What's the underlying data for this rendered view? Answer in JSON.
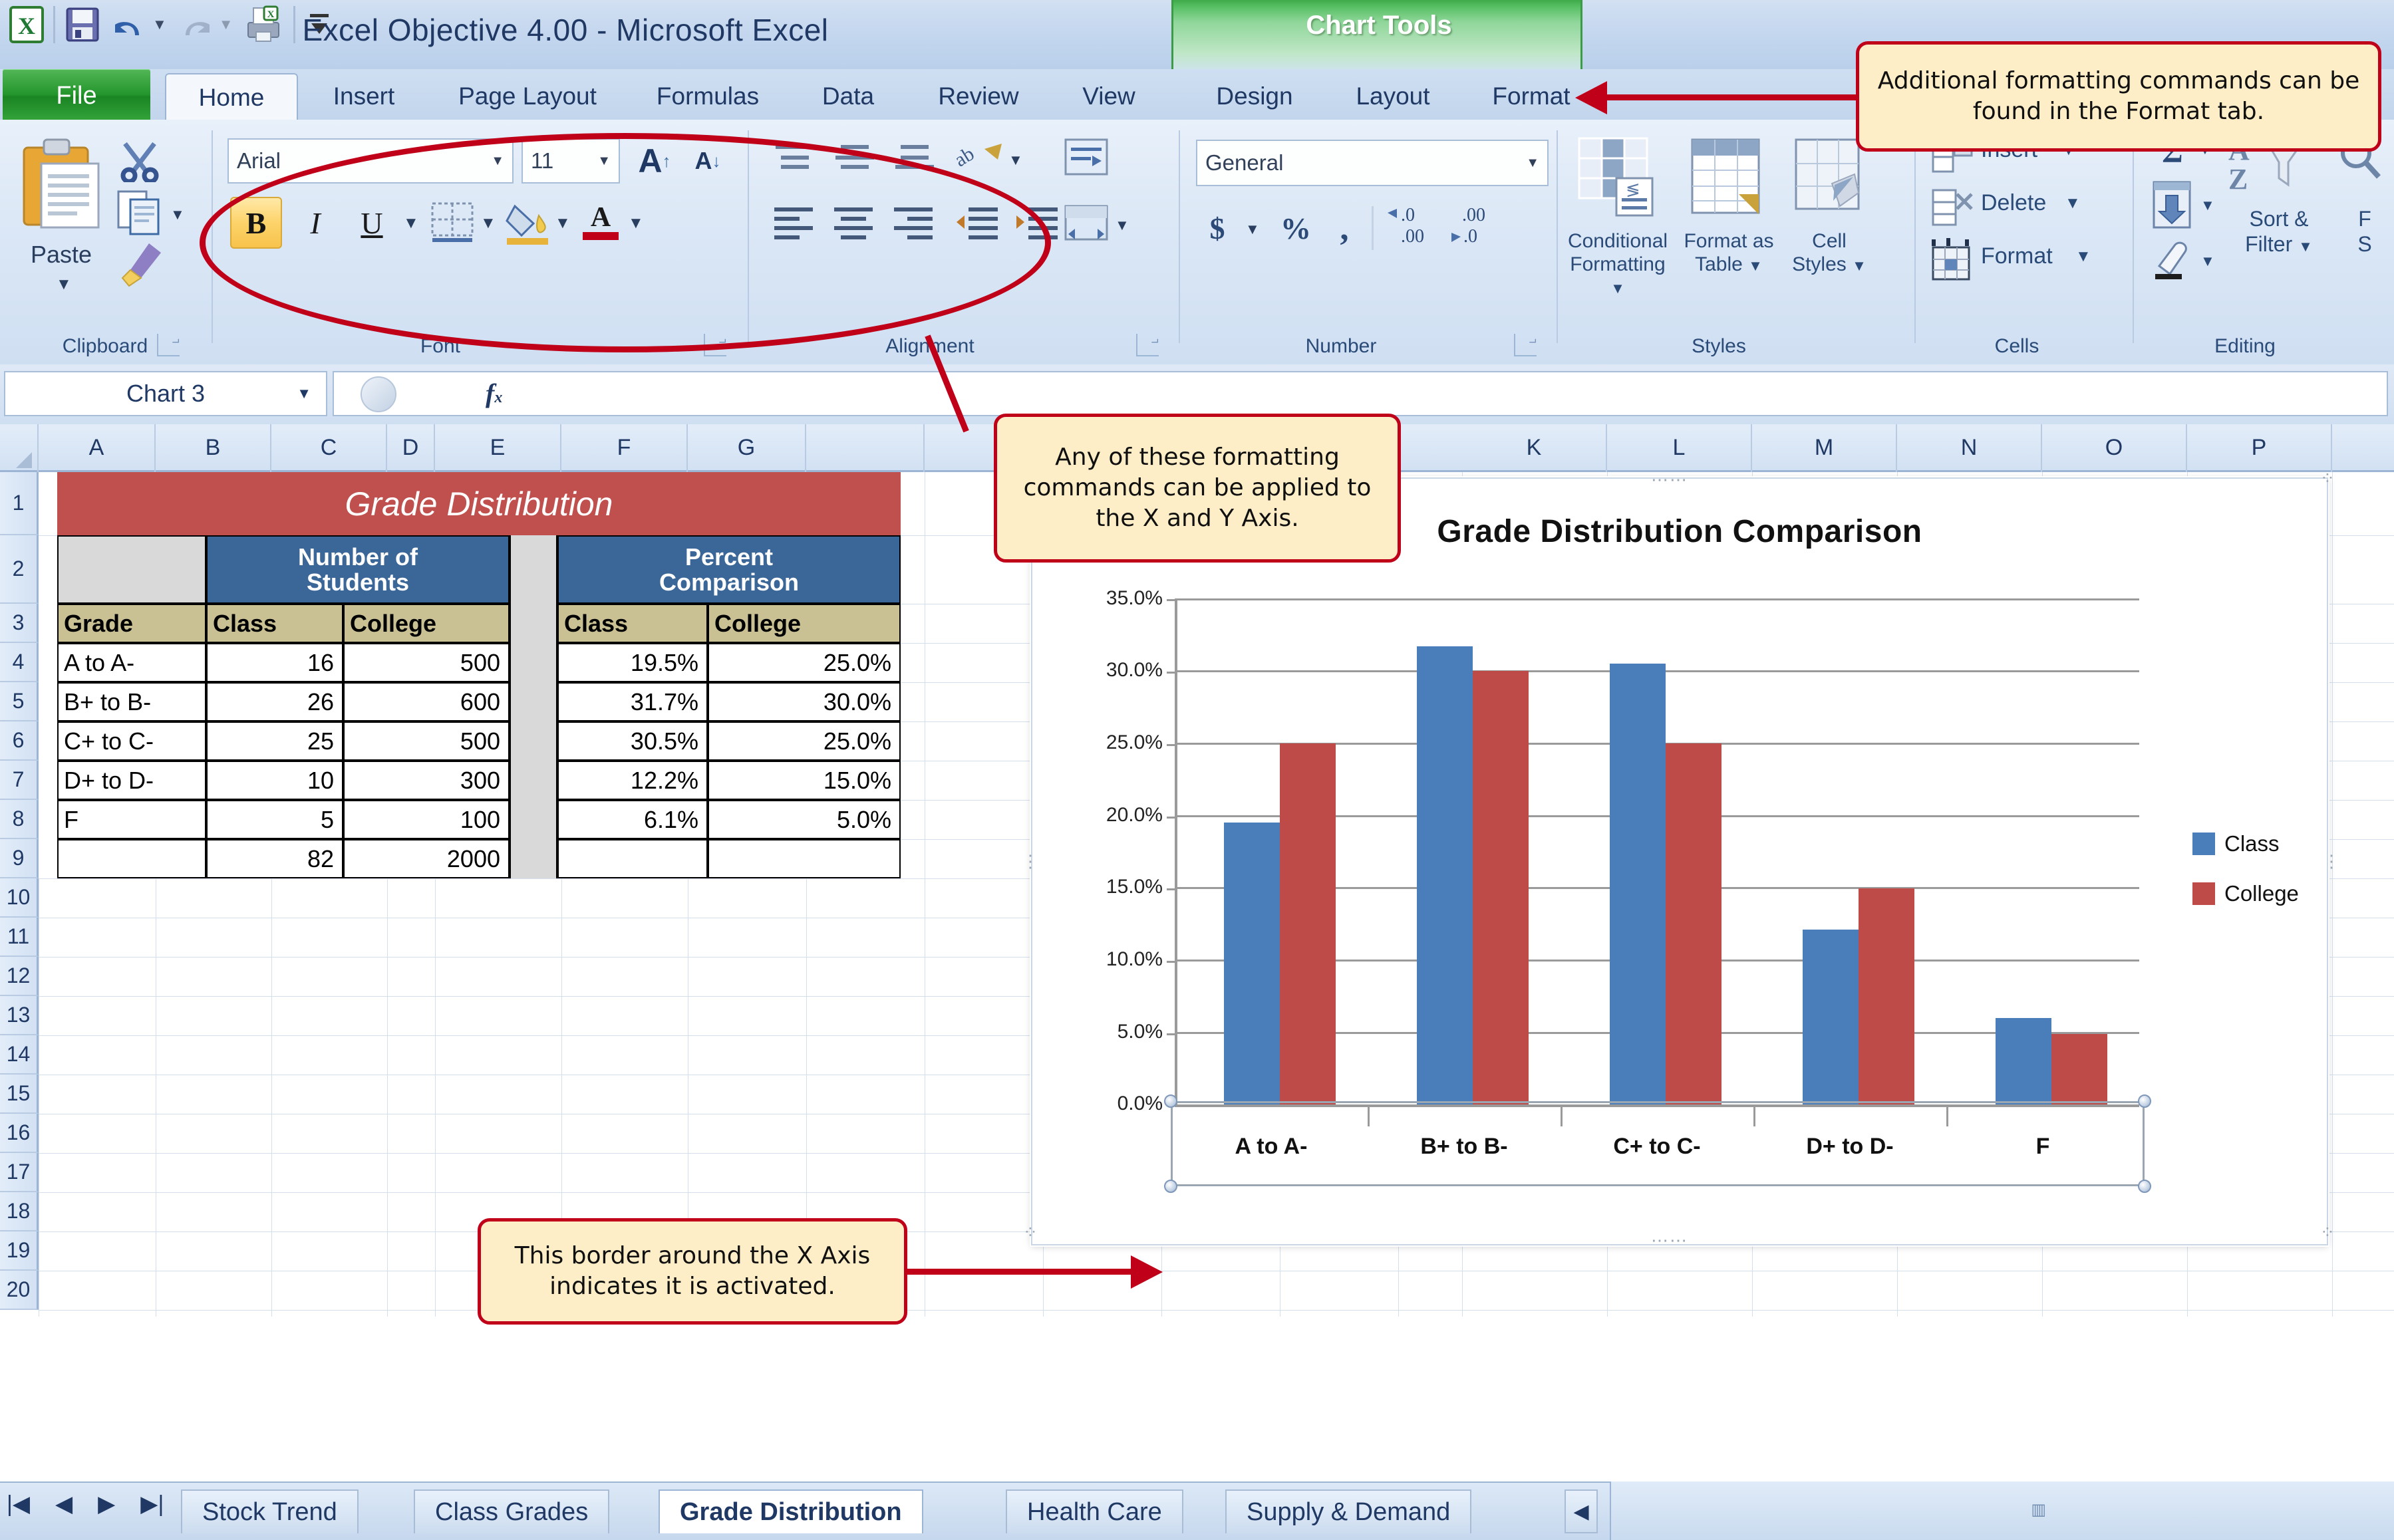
{
  "window": {
    "app_title": "Excel Objective 4.00  -  Microsoft Excel",
    "contextual_tools_label": "Chart Tools"
  },
  "quick_access": {
    "icons": [
      "excel-logo-icon",
      "save-icon",
      "undo-icon",
      "redo-icon",
      "print-preview-icon",
      "customize-qat-icon"
    ]
  },
  "ribbon": {
    "tabs": [
      {
        "label": "File",
        "active": false,
        "style": "file"
      },
      {
        "label": "Home",
        "active": true
      },
      {
        "label": "Insert",
        "active": false
      },
      {
        "label": "Page Layout",
        "active": false
      },
      {
        "label": "Formulas",
        "active": false
      },
      {
        "label": "Data",
        "active": false
      },
      {
        "label": "Review",
        "active": false
      },
      {
        "label": "View",
        "active": false
      }
    ],
    "contextual_tabs": [
      {
        "label": "Design",
        "active": false
      },
      {
        "label": "Layout",
        "active": false
      },
      {
        "label": "Format",
        "active": false
      }
    ],
    "groups": [
      {
        "label": "Clipboard"
      },
      {
        "label": "Font"
      },
      {
        "label": "Alignment"
      },
      {
        "label": "Number"
      },
      {
        "label": "Styles"
      },
      {
        "label": "Cells"
      },
      {
        "label": "Editing"
      }
    ],
    "clipboard": {
      "paste_label": "Paste",
      "cut_icon": "scissors-icon",
      "copy_icon": "copy-icon",
      "format_painter_icon": "format-painter-icon"
    },
    "font": {
      "font_name": "Arial",
      "font_size": "11",
      "grow_font_label": "A",
      "shrink_font_label": "A",
      "bold_label": "B",
      "italic_label": "I",
      "underline_label": "U",
      "borders_icon": "borders-icon",
      "fill_color_icon": "fill-color-icon",
      "font_color_icon": "font-color-icon"
    },
    "alignment": {
      "top_align_icon": "align-top-icon",
      "middle_align_icon": "align-middle-icon",
      "bottom_align_icon": "align-bottom-icon",
      "orientation_icon": "text-orientation-icon",
      "wrap_text_icon": "wrap-text-icon",
      "align_left_icon": "align-left-icon",
      "align_center_icon": "align-center-icon",
      "align_right_icon": "align-right-icon",
      "decrease_indent_icon": "decrease-indent-icon",
      "increase_indent_icon": "increase-indent-icon",
      "merge_center_icon": "merge-and-center-icon"
    },
    "number": {
      "format_value": "General",
      "accounting_icon": "currency-icon",
      "percent_icon": "percent-style-icon",
      "comma_icon": "comma-style-icon",
      "increase_decimal_icon": "increase-decimal-icon",
      "decrease_decimal_icon": "decrease-decimal-icon"
    },
    "styles": {
      "conditional_formatting_label": "Conditional\nFormatting",
      "conditional_line1": "Conditional",
      "conditional_line2": "Formatting",
      "format_as_table_line1": "Format as",
      "format_as_table_line2": "Table",
      "cell_styles_line1": "Cell",
      "cell_styles_line2": "Styles"
    },
    "cells": {
      "insert_label": "Insert",
      "delete_label": "Delete",
      "format_label": "Format"
    },
    "editing": {
      "autosum_icon": "autosum-icon",
      "fill_icon": "fill-down-icon",
      "clear_icon": "clear-eraser-icon",
      "sort_filter_line1": "Sort &",
      "sort_filter_line2": "Filter",
      "find_select_line1": "F",
      "find_select_line2": "S"
    }
  },
  "formula_bar": {
    "name_box_value": "Chart 3",
    "fx_label": "fx",
    "formula_value": ""
  },
  "grid": {
    "columns": [
      "A",
      "B",
      "C",
      "D",
      "E",
      "F",
      "G",
      "K",
      "L",
      "M",
      "N",
      "O",
      "P"
    ],
    "rows": [
      "1",
      "2",
      "3",
      "4",
      "5",
      "6",
      "7",
      "8",
      "9",
      "10",
      "11",
      "12",
      "13",
      "14",
      "15",
      "16",
      "17",
      "18",
      "19",
      "20"
    ]
  },
  "worksheet": {
    "title": "Grade Distribution",
    "group_headers": [
      {
        "label": "Number of Students",
        "line1": "Number of",
        "line2": "Students"
      },
      {
        "label": "Percent Comparison",
        "line1": "Percent",
        "line2": "Comparison"
      }
    ],
    "column_headers": [
      "Grade",
      "Class",
      "College",
      "Class",
      "College"
    ],
    "rows": [
      {
        "grade": "A to A-",
        "class_count": "16",
        "college_count": "500",
        "class_pct": "19.5%",
        "college_pct": "25.0%"
      },
      {
        "grade": "B+ to B-",
        "class_count": "26",
        "college_count": "600",
        "class_pct": "31.7%",
        "college_pct": "30.0%"
      },
      {
        "grade": "C+ to C-",
        "class_count": "25",
        "college_count": "500",
        "class_pct": "30.5%",
        "college_pct": "25.0%"
      },
      {
        "grade": "D+ to D-",
        "class_count": "10",
        "college_count": "300",
        "class_pct": "12.2%",
        "college_pct": "15.0%"
      },
      {
        "grade": "F",
        "class_count": "5",
        "college_count": "100",
        "class_pct": "6.1%",
        "college_pct": "5.0%"
      }
    ],
    "totals": {
      "grade": "",
      "class_count": "82",
      "college_count": "2000",
      "class_pct": "",
      "college_pct": ""
    }
  },
  "chart_data": {
    "type": "bar",
    "title": "Grade Distribution  Comparison",
    "categories": [
      "A to A-",
      "B+ to B-",
      "C+ to C-",
      "D+ to D-",
      "F"
    ],
    "series": [
      {
        "name": "Class",
        "color": "#4a7ebb",
        "values": [
          19.5,
          31.7,
          30.5,
          12.2,
          6.1
        ]
      },
      {
        "name": "College",
        "color": "#be4b48",
        "values": [
          25.0,
          30.0,
          25.0,
          15.0,
          5.0
        ]
      }
    ],
    "ylim": [
      0,
      35
    ],
    "ytick_values": [
      35.0,
      30.0,
      25.0,
      20.0,
      15.0,
      10.0,
      5.0,
      0.0
    ],
    "ytick_labels": [
      "35.0%",
      "30.0%",
      "25.0%",
      "20.0%",
      "15.0%",
      "10.0%",
      "5.0%",
      "0.0%"
    ],
    "xlabel": "",
    "ylabel": "",
    "grid": true,
    "legend_position": "right",
    "selected_element": "x-axis"
  },
  "callouts": [
    {
      "id": "format-tab-callout",
      "text": "Additional formatting commands can be found in the Format tab."
    },
    {
      "id": "formatting-commands-callout",
      "text": "Any of these formatting commands can be applied to the X and Y Axis."
    },
    {
      "id": "x-axis-border-callout",
      "text": "This border around the X Axis indicates it is activated."
    }
  ],
  "sheet_tabs": {
    "nav_icons": [
      "first-sheet-icon",
      "previous-sheet-icon",
      "next-sheet-icon",
      "last-sheet-icon"
    ],
    "tabs": [
      {
        "label": "Stock Trend",
        "active": false
      },
      {
        "label": "Class Grades",
        "active": false
      },
      {
        "label": "Grade Distribution",
        "active": true
      },
      {
        "label": "Health Care",
        "active": false
      },
      {
        "label": "Supply & Demand",
        "active": false
      }
    ]
  },
  "colors": {
    "class_series": "#4a7ebb",
    "college_series": "#be4b48",
    "title_fill": "#c0504d",
    "group_header_fill": "#3b6698",
    "column_header_fill": "#c9c193",
    "callout_fill": "#fdeec8",
    "callout_border": "#c00018"
  }
}
